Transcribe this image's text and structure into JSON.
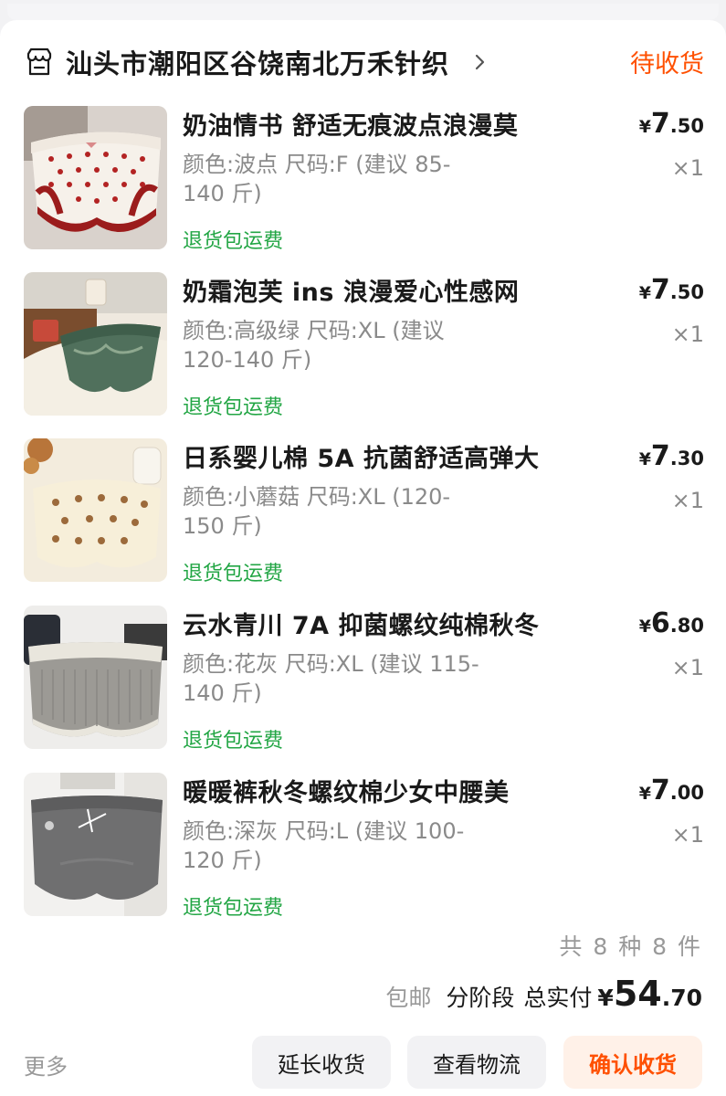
{
  "shop": {
    "name": "汕头市潮阳区谷饶南北万禾针织",
    "status": "待收货"
  },
  "items": [
    {
      "title": "奶油情书 舒适无痕波点浪漫莫",
      "spec": "颜色:波点 尺码:F (建议 85-140 斤)",
      "tag": "退货包运费",
      "price_yen": "¥",
      "price_int": "7",
      "price_dec": ".50",
      "qty": "×1"
    },
    {
      "title": "奶霜泡芙 ins 浪漫爱心性感网",
      "spec": "颜色:高级绿 尺码:XL (建议 120-140 斤)",
      "tag": "退货包运费",
      "price_yen": "¥",
      "price_int": "7",
      "price_dec": ".50",
      "qty": "×1"
    },
    {
      "title": "日系婴儿棉 5A 抗菌舒适高弹大",
      "spec": "颜色:小蘑菇 尺码:XL (120-150 斤)",
      "tag": "退货包运费",
      "price_yen": "¥",
      "price_int": "7",
      "price_dec": ".30",
      "qty": "×1"
    },
    {
      "title": "云水青川 7A 抑菌螺纹纯棉秋冬",
      "spec": "颜色:花灰 尺码:XL (建议 115-140 斤)",
      "tag": "退货包运费",
      "price_yen": "¥",
      "price_int": "6",
      "price_dec": ".80",
      "qty": "×1"
    },
    {
      "title": "暖暖裤秋冬螺纹棉少女中腰美",
      "spec": "颜色:深灰 尺码:L (建议 100-120 斤)",
      "tag": "退货包运费",
      "price_yen": "¥",
      "price_int": "7",
      "price_dec": ".00",
      "qty": "×1"
    }
  ],
  "summary": {
    "count": "共 8 种 8 件",
    "shipping": "包邮",
    "stage": "分阶段",
    "total_label": "总实付",
    "total_yen": "¥",
    "total_int": "54",
    "total_dec": ".70"
  },
  "footer": {
    "more": "更多",
    "extend": "延长收货",
    "logistics": "查看物流",
    "confirm": "确认收货"
  },
  "colors": {
    "accent": "#ff5000",
    "green_tag": "#23a645",
    "muted": "#8a8a8a",
    "button_bg": "#f2f2f4",
    "primary_button_bg": "#fff1e8"
  }
}
